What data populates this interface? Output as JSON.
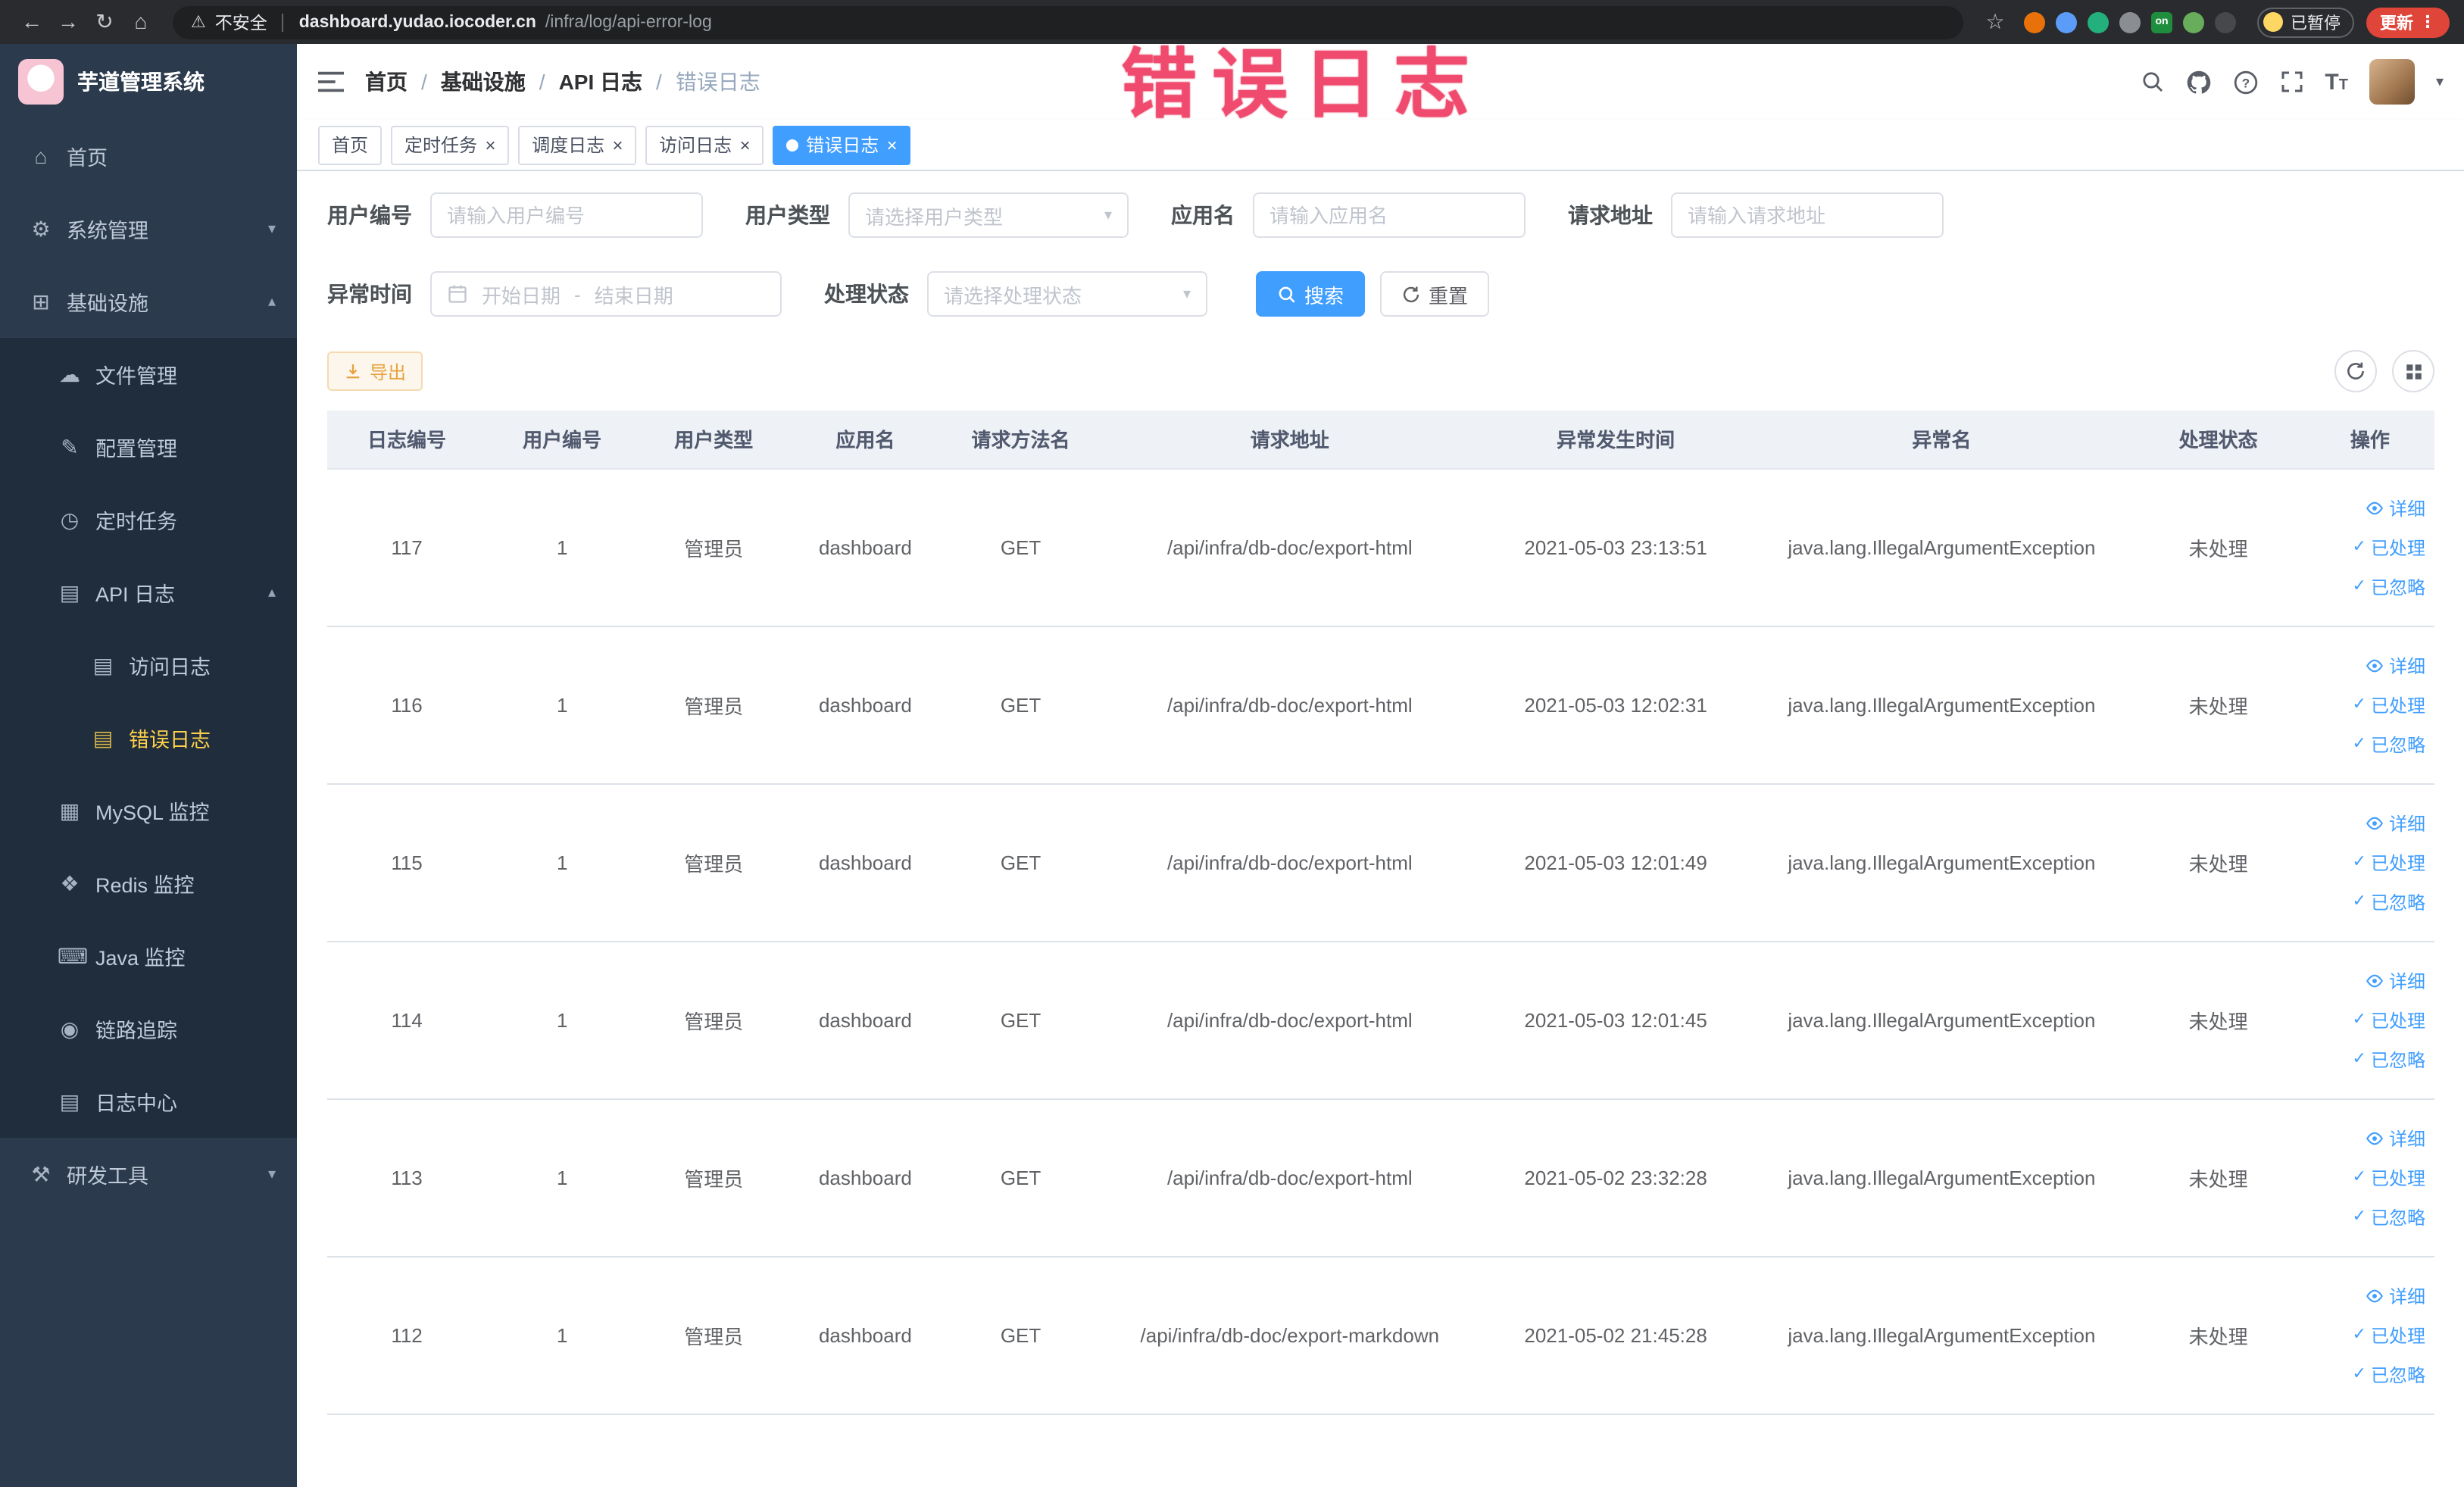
{
  "annotation": {
    "text": "错误日志"
  },
  "colors": {
    "primary": "#409eff",
    "warning": "#e6a23c",
    "active_menu": "#ffd04b",
    "annotation": "#f04a6e"
  },
  "browser": {
    "security_label": "不安全",
    "url_host": "dashboard.yudao.iocoder.cn",
    "url_path": "/infra/log/api-error-log",
    "paused_label": "已暂停",
    "update_label": "更新",
    "extensions": [
      {
        "name": "extension-orange-icon",
        "color": "#e8710a"
      },
      {
        "name": "extension-blue-icon",
        "color": "#5b9cf8"
      },
      {
        "name": "extension-green-icon",
        "color": "#23b07c"
      },
      {
        "name": "extension-grid-icon",
        "color": "#8a8d91"
      },
      {
        "name": "extension-on-badge",
        "color": "#1e8e3e",
        "text": "on"
      },
      {
        "name": "extension-leaf-icon",
        "color": "#67ad5b"
      },
      {
        "name": "extension-dark-icon",
        "color": "#46484b"
      }
    ]
  },
  "sidebar": {
    "logo_title": "芋道管理系统",
    "items": [
      {
        "id": "home",
        "label": "首页",
        "icon": "home",
        "level": 0
      },
      {
        "id": "system",
        "label": "系统管理",
        "icon": "gear",
        "level": 0,
        "chevron": "down"
      },
      {
        "id": "infra",
        "label": "基础设施",
        "icon": "infra",
        "level": 0,
        "chevron": "up"
      },
      {
        "id": "file",
        "label": "文件管理",
        "icon": "file",
        "level": 1,
        "sub": true
      },
      {
        "id": "config",
        "label": "配置管理",
        "icon": "config",
        "level": 1,
        "sub": true
      },
      {
        "id": "job",
        "label": "定时任务",
        "icon": "timer",
        "level": 1,
        "sub": true
      },
      {
        "id": "api-log",
        "label": "API 日志",
        "icon": "api",
        "level": 1,
        "sub": true,
        "chevron": "up"
      },
      {
        "id": "access-log",
        "label": "访问日志",
        "icon": "doc",
        "level": 2,
        "sub": true
      },
      {
        "id": "error-log",
        "label": "错误日志",
        "icon": "doc",
        "level": 2,
        "sub": true,
        "active": true
      },
      {
        "id": "mysql",
        "label": "MySQL 监控",
        "icon": "db",
        "level": 1,
        "sub": true
      },
      {
        "id": "redis",
        "label": "Redis 监控",
        "icon": "redis",
        "level": 1,
        "sub": true
      },
      {
        "id": "java",
        "label": "Java 监控",
        "icon": "java",
        "level": 1,
        "sub": true
      },
      {
        "id": "trace",
        "label": "链路追踪",
        "icon": "trace",
        "level": 1,
        "sub": true
      },
      {
        "id": "log-center",
        "label": "日志中心",
        "icon": "log",
        "level": 1,
        "sub": true
      },
      {
        "id": "dev-tools",
        "label": "研发工具",
        "icon": "tools",
        "level": 0,
        "chevron": "down"
      }
    ]
  },
  "header": {
    "breadcrumb": [
      "首页",
      "基础设施",
      "API 日志",
      "错误日志"
    ]
  },
  "tabs": [
    {
      "label": "首页"
    },
    {
      "label": "定时任务",
      "closable": true
    },
    {
      "label": "调度日志",
      "closable": true
    },
    {
      "label": "访问日志",
      "closable": true
    },
    {
      "label": "错误日志",
      "closable": true,
      "active": true
    }
  ],
  "filters": {
    "user_id": {
      "label": "用户编号",
      "placeholder": "请输入用户编号"
    },
    "user_type": {
      "label": "用户类型",
      "placeholder": "请选择用户类型"
    },
    "app_name": {
      "label": "应用名",
      "placeholder": "请输入应用名"
    },
    "request_url": {
      "label": "请求地址",
      "placeholder": "请输入请求地址"
    },
    "exception_time": {
      "label": "异常时间",
      "start_placeholder": "开始日期",
      "separator": "-",
      "end_placeholder": "结束日期"
    },
    "process_status": {
      "label": "处理状态",
      "placeholder": "请选择处理状态"
    },
    "search_label": "搜索",
    "reset_label": "重置"
  },
  "toolbar": {
    "export_label": "导出"
  },
  "table": {
    "columns": [
      "日志编号",
      "用户编号",
      "用户类型",
      "应用名",
      "请求方法名",
      "请求地址",
      "异常发生时间",
      "异常名",
      "处理状态",
      "操作"
    ],
    "op_labels": [
      "详细",
      "已处理",
      "已忽略"
    ],
    "rows": [
      {
        "log_id": "117",
        "user_id": "1",
        "user_type": "管理员",
        "app_name": "dashboard",
        "method": "GET",
        "url": "/api/infra/db-doc/export-html",
        "time": "2021-05-03 23:13:51",
        "exception": "java.lang.IllegalArgumentException",
        "status": "未处理"
      },
      {
        "log_id": "116",
        "user_id": "1",
        "user_type": "管理员",
        "app_name": "dashboard",
        "method": "GET",
        "url": "/api/infra/db-doc/export-html",
        "time": "2021-05-03 12:02:31",
        "exception": "java.lang.IllegalArgumentException",
        "status": "未处理"
      },
      {
        "log_id": "115",
        "user_id": "1",
        "user_type": "管理员",
        "app_name": "dashboard",
        "method": "GET",
        "url": "/api/infra/db-doc/export-html",
        "time": "2021-05-03 12:01:49",
        "exception": "java.lang.IllegalArgumentException",
        "status": "未处理"
      },
      {
        "log_id": "114",
        "user_id": "1",
        "user_type": "管理员",
        "app_name": "dashboard",
        "method": "GET",
        "url": "/api/infra/db-doc/export-html",
        "time": "2021-05-03 12:01:45",
        "exception": "java.lang.IllegalArgumentException",
        "status": "未处理"
      },
      {
        "log_id": "113",
        "user_id": "1",
        "user_type": "管理员",
        "app_name": "dashboard",
        "method": "GET",
        "url": "/api/infra/db-doc/export-html",
        "time": "2021-05-02 23:32:28",
        "exception": "java.lang.IllegalArgumentException",
        "status": "未处理"
      },
      {
        "log_id": "112",
        "user_id": "1",
        "user_type": "管理员",
        "app_name": "dashboard",
        "method": "GET",
        "url": "/api/infra/db-doc/export-markdown",
        "time": "2021-05-02 21:45:28",
        "exception": "java.lang.IllegalArgumentException",
        "status": "未处理"
      }
    ]
  }
}
